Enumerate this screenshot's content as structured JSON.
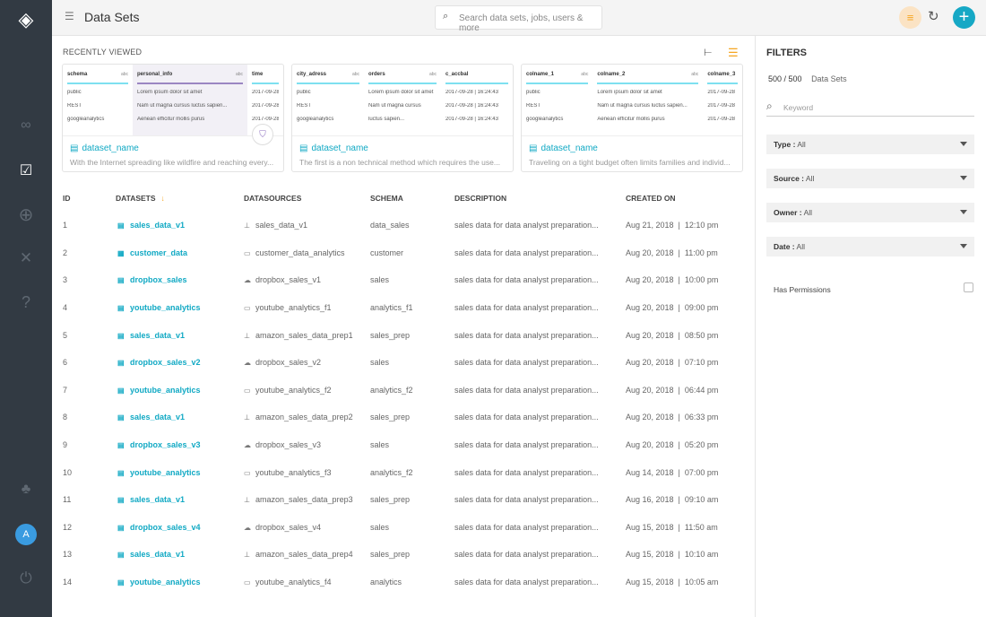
{
  "header": {
    "title": "Data Sets",
    "search_placeholder": "Search data sets, jobs, users & more"
  },
  "sidebar": {
    "avatar": "A"
  },
  "recent": {
    "label": "RECENTLY VIEWED",
    "cards": [
      {
        "name": "dataset_name",
        "desc": "With the Internet spreading like wildfire and reaching every...",
        "cols": [
          {
            "h": "schema",
            "t": "abc",
            "cells": [
              "public",
              "REST",
              "googleanalytics"
            ]
          },
          {
            "h": "personal_info",
            "t": "abc",
            "cells": [
              "Lorem ipsum dolor sit amet",
              "Nam ut magna cursus luctus sapien...",
              "Aenean efficitur mollis purus"
            ]
          },
          {
            "h": "time",
            "t": "",
            "cells": [
              "2017-09-28",
              "2017-09-28",
              "2017-09-28"
            ]
          }
        ]
      },
      {
        "name": "dataset_name",
        "desc": "The first is a non technical method which requires the use...",
        "cols": [
          {
            "h": "city_adress",
            "t": "abc",
            "cells": [
              "public",
              "REST",
              "googleanalytics"
            ]
          },
          {
            "h": "orders",
            "t": "abc",
            "cells": [
              "Lorem ipsum dolor sit amet",
              "Nam ut magna cursus",
              "luctus sapien..."
            ]
          },
          {
            "h": "c_accbal",
            "t": "",
            "cells": [
              "2017-09-28  |  16:24:43",
              "2017-09-28  |  16:24:43",
              "2017-09-28  |  16:24:43"
            ]
          }
        ]
      },
      {
        "name": "dataset_name",
        "desc": "Traveling on a tight budget often limits families and individ...",
        "cols": [
          {
            "h": "colname_1",
            "t": "abc",
            "cells": [
              "public",
              "REST",
              "googleanalytics"
            ]
          },
          {
            "h": "colname_2",
            "t": "abc",
            "cells": [
              "Lorem ipsum dolor sit amet",
              "Nam ut magna cursus luctus sapien...",
              "Aenean efficitur mollis purus"
            ]
          },
          {
            "h": "colname_3",
            "t": "",
            "cells": [
              "2017-09-28",
              "2017-09-28",
              "2017-09-28"
            ]
          }
        ]
      }
    ]
  },
  "table": {
    "headers": [
      "ID",
      "DATASETS",
      "DATASOURCES",
      "SCHEMA",
      "DESCRIPTION",
      "CREATED ON"
    ],
    "rows": [
      [
        "1",
        "sales_data_v1",
        "sales_data_v1",
        "data_sales",
        "sales data for data analyst preparation...",
        "Aug 21, 2018  |  12:10 pm",
        "file",
        "server"
      ],
      [
        "2",
        "customer_data",
        "customer_data_analytics",
        "customer",
        "sales data for data analyst preparation...",
        "Aug 20, 2018  |  11:00 pm",
        "table",
        "monitor"
      ],
      [
        "3",
        "dropbox_sales",
        "dropbox_sales_v1",
        "sales",
        "sales data for data analyst preparation...",
        "Aug 20, 2018  |  10:00 pm",
        "file",
        "cloud"
      ],
      [
        "4",
        "youtube_analytics",
        "youtube_analytics_f1",
        "analytics_f1",
        "sales data for data analyst preparation...",
        "Aug 20, 2018  |  09:00 pm",
        "file",
        "monitor"
      ],
      [
        "5",
        "sales_data_v1",
        "amazon_sales_data_prep1",
        "sales_prep",
        "sales data for data analyst preparation...",
        "Aug 20, 2018  |  08:50 pm",
        "file",
        "server"
      ],
      [
        "6",
        "dropbox_sales_v2",
        "dropbox_sales_v2",
        "sales",
        "sales data for data analyst preparation...",
        "Aug 20, 2018  |  07:10 pm",
        "file",
        "cloud"
      ],
      [
        "7",
        "youtube_analytics",
        "youtube_analytics_f2",
        "analytics_f2",
        "sales data for data analyst preparation...",
        "Aug 20, 2018  |  06:44 pm",
        "file",
        "monitor"
      ],
      [
        "8",
        "sales_data_v1",
        "amazon_sales_data_prep2",
        "sales_prep",
        "sales data for data analyst preparation...",
        "Aug 20, 2018  |  06:33 pm",
        "file",
        "server"
      ],
      [
        "9",
        "dropbox_sales_v3",
        "dropbox_sales_v3",
        "sales",
        "sales data for data analyst preparation...",
        "Aug 20, 2018  |  05:20 pm",
        "file",
        "cloud"
      ],
      [
        "10",
        "youtube_analytics",
        "youtube_analytics_f3",
        "analytics_f2",
        "sales data for data analyst preparation...",
        "Aug 14, 2018  |  07:00 pm",
        "file",
        "monitor"
      ],
      [
        "11",
        "sales_data_v1",
        "amazon_sales_data_prep3",
        "sales_prep",
        "sales data for data analyst preparation...",
        "Aug 16, 2018  |  09:10 am",
        "file",
        "server"
      ],
      [
        "12",
        "dropbox_sales_v4",
        "dropbox_sales_v4",
        "sales",
        "sales data for data analyst preparation...",
        "Aug 15, 2018  |  11:50 am",
        "file",
        "cloud"
      ],
      [
        "13",
        "sales_data_v1",
        "amazon_sales_data_prep4",
        "sales_prep",
        "sales data for data analyst preparation...",
        "Aug 15, 2018  |  10:10 am",
        "file",
        "server"
      ],
      [
        "14",
        "youtube_analytics",
        "youtube_analytics_f4",
        "analytics",
        "sales data for data analyst preparation...",
        "Aug 15, 2018  |  10:05 am",
        "file",
        "monitor"
      ]
    ]
  },
  "filters": {
    "title": "FILTERS",
    "count": "500 / 500",
    "count_label": "Data Sets",
    "keyword_placeholder": "Keyword",
    "selects": [
      {
        "label": "Type :",
        "value": "All"
      },
      {
        "label": "Source :",
        "value": "All"
      },
      {
        "label": "Owner :",
        "value": "All"
      },
      {
        "label": "Date :",
        "value": "All"
      }
    ],
    "has_permissions": "Has Permissions"
  },
  "colors": {
    "accent": "#11a9c4",
    "orange": "#f5a623",
    "sidebar": "#323a43"
  }
}
